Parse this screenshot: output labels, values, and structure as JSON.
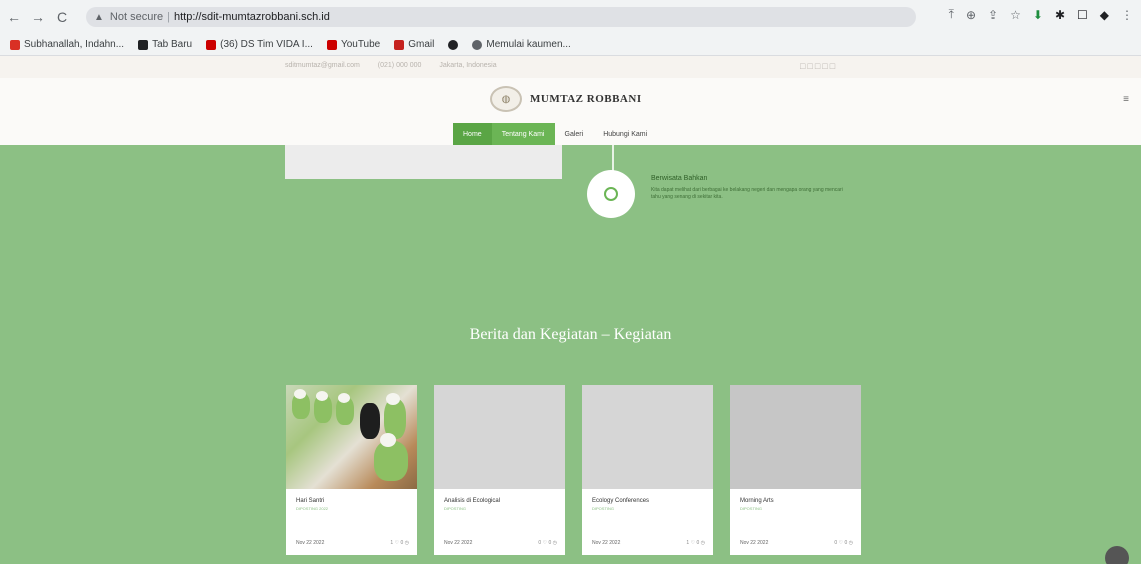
{
  "browser": {
    "back": "←",
    "forward": "→",
    "reload": "C",
    "not_secure": "Not secure",
    "url": "http://sdit-mumtazrobbani.sch.id",
    "lock": "▲",
    "right_icons": [
      "⤒",
      "⊕",
      "⇪",
      "☆",
      "⬇",
      "✱",
      "☐",
      "◆",
      "⋮"
    ]
  },
  "bookmarks": [
    {
      "label": "Subhanallah, Indahn...",
      "color": "#d93025"
    },
    {
      "label": "Tab Baru",
      "color": "#202124"
    },
    {
      "label": "(36) DS Tim VIDA I...",
      "color": "#cc0000"
    },
    {
      "label": "YouTube",
      "color": "#cc0000"
    },
    {
      "label": "Gmail",
      "color": "#c5221f"
    },
    {
      "label": "",
      "color": "#202124"
    },
    {
      "label": "Memulai kaumen...",
      "color": "#5f6368"
    }
  ],
  "topbar": {
    "items": [
      "sditmumtaz@gmail.com",
      "(021) 000 000",
      "Jakarta, Indonesia"
    ],
    "social": "□□□□□"
  },
  "header": {
    "brand": "MUMTAZ ROBBANI",
    "menu_icon": "≡"
  },
  "nav": {
    "items": [
      "Home",
      "Tentang Kami",
      "Galeri",
      "Hubungi Kami"
    ]
  },
  "timeline": {
    "title": "Berwisata Bahkan",
    "text": "Kita dapat melihat dari berbagai ke belakang negeri dan mengapa orang yang mencari tahu yang senang di sekitar kita."
  },
  "section": {
    "title": "Berita dan Kegiatan – Kegiatan"
  },
  "cards": [
    {
      "title": "Hari Santri",
      "sub": "DIPOSTING 2022",
      "date": "Nov 22 2022",
      "stats": "1 ♡  0 ◷"
    },
    {
      "title": "Analisis di Ecological",
      "sub": "DIPOSTING",
      "date": "Nov 22 2022",
      "stats": "0 ♡  0 ◷"
    },
    {
      "title": "Ecology Conferences",
      "sub": "DIPOSTING",
      "date": "Nov 22 2022",
      "stats": "1 ♡  0 ◷"
    },
    {
      "title": "Morning Arts",
      "sub": "DIPOSTING",
      "date": "Nov 22 2022",
      "stats": "0 ♡  0 ◷"
    }
  ]
}
